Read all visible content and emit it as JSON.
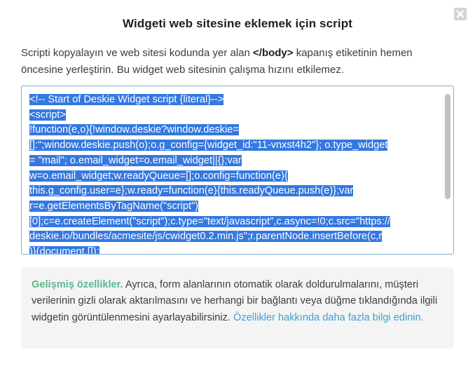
{
  "modal": {
    "title": "Widgeti web sitesine eklemek için script",
    "close_icon": "close-icon"
  },
  "description": {
    "before": "Scripti kopyalayın ve web sitesi kodunda yer alan ",
    "tag": "</body>",
    "after": " kapanış etiketinin hemen öncesine yerleştirin. Bu widget web sitesinin çalışma hızını etkilemez."
  },
  "code": {
    "lines": [
      "<!-- Start of Deskie Widget script {literal}-->",
      "<script>",
      "!function(e,o){!window.deskie?window.deskie=",
      "[]:\";window.deskie.push(o);o.g_config={widget_id:\"11-vnxst4h2\"}; o.type_widget",
      "= \"mail\"; o.email_widget=o.email_widget||{};var",
      "w=o.email_widget;w.readyQueue=[];o.config=function(e){",
      "this.g_config.user=e};w.ready=function(e){this.readyQueue.push(e)};var",
      "r=e.getElementsByTagName(\"script\")",
      "[0];c=e.createElement(\"script\");c.type=\"text/javascript\",c.async=!0;c.src=\"https://",
      "deskie.io/bundles/acmesite/js/cwidget0.2.min.js\";r.parentNode.insertBefore(c,r",
      ")}(document,[]);"
    ],
    "selection_color": "#3478e0"
  },
  "info": {
    "heading": "Gelişmiş özellikler.",
    "body": " Ayrıca, form alanlarının otomatik olarak doldurulmalarını, müşteri verilerinin gizli olarak aktarılmasını ve herhangi bir bağlantı veya düğme tıklandığında ilgili widgetin görüntülenmesini ayarlayabilirsiniz. ",
    "link": "Özellikler hakkında daha fazla bilgi edinin."
  },
  "colors": {
    "accent_green": "#5cb88f",
    "link_blue": "#3d9fd6",
    "code_border": "#7ab0d9"
  }
}
